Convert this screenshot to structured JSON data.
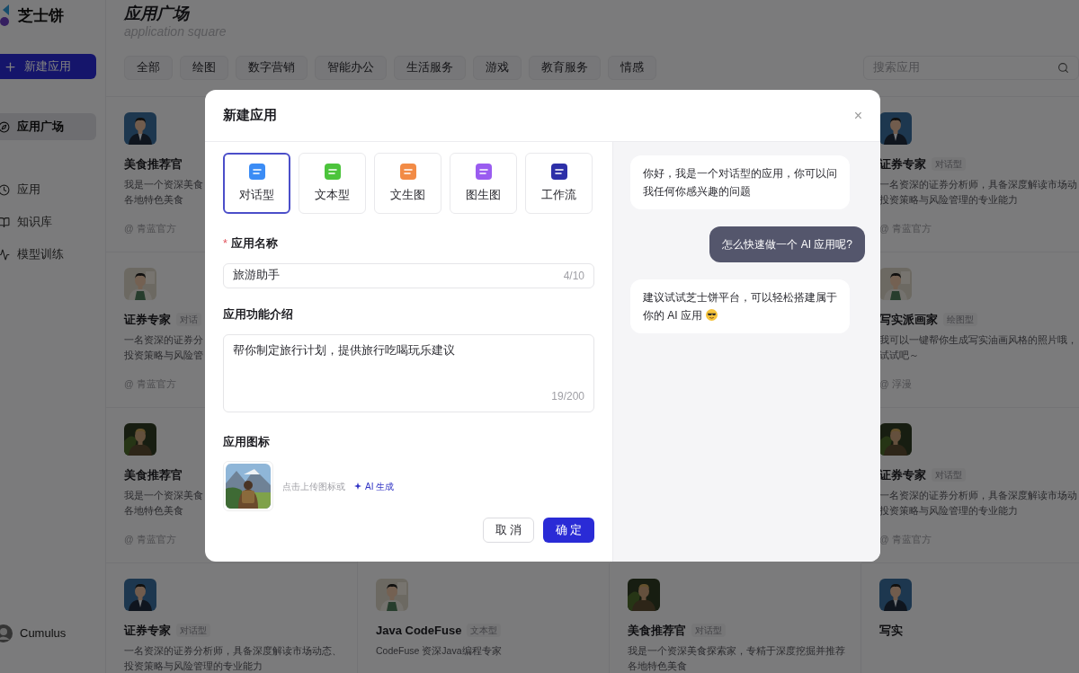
{
  "sidebar": {
    "logo": "芝士饼",
    "new_button": "新建应用",
    "nav": [
      {
        "label": "应用广场",
        "selected": true
      },
      {
        "label": "应用",
        "selected": false
      },
      {
        "label": "知识库",
        "selected": false
      },
      {
        "label": "模型训练",
        "selected": false
      }
    ],
    "user": {
      "name": "Cumulus"
    }
  },
  "page": {
    "title": "应用广场",
    "subtitle": "application square"
  },
  "filters": [
    "全部",
    "绘图",
    "数字营销",
    "智能办公",
    "生活服务",
    "游戏",
    "教育服务",
    "情感"
  ],
  "search": {
    "placeholder": "搜索应用"
  },
  "left_column": [
    {
      "title": "美食推荐官",
      "lines": [
        "我是一个资深美食",
        "各地特色美食"
      ],
      "author": "@ 青蓝官方"
    },
    {
      "title": "证券专家",
      "badge": "对话",
      "lines": [
        "一名资深的证券分",
        "投资策略与风险管"
      ],
      "author": "@ 青蓝官方"
    },
    {
      "title": "美食推荐官",
      "lines": [
        "我是一个资深美食",
        "各地特色美食"
      ],
      "author": "@ 青蓝官方"
    }
  ],
  "right_column": [
    {
      "title": "证券专家",
      "badge": "对话型",
      "lines": [
        "一名资深的证券分析师，具备深度解读市场动",
        "投资策略与风险管理的专业能力"
      ],
      "author": "@ 青蓝官方"
    },
    {
      "title": "写实派画家",
      "badge": "绘图型",
      "lines": [
        "我可以一键帮你生成写实油画风格的照片哦，",
        "试试吧～"
      ],
      "author": "@ 浮漫"
    },
    {
      "title": "证券专家",
      "badge": "对话型",
      "lines": [
        "一名资深的证券分析师，具备深度解读市场动",
        "投资策略与风险管理的专业能力"
      ],
      "author": "@ 青蓝官方"
    }
  ],
  "bottom_row": [
    {
      "title": "证券专家",
      "badge": "对话型",
      "lines": [
        "一名资深的证券分析师，具备深度解读市场动态、",
        "投资策略与风险管理的专业能力"
      ]
    },
    {
      "title": "Java CodeFuse",
      "badge": "文本型",
      "lines": [
        "CodeFuse 资深Java编程专家"
      ]
    },
    {
      "title": "美食推荐官",
      "badge": "对话型",
      "lines": [
        "我是一个资深美食探索家，专精于深度挖掘并推荐",
        "各地特色美食"
      ]
    },
    {
      "title": "写实"
    }
  ],
  "dialog": {
    "title": "新建应用",
    "close": "×",
    "types": [
      {
        "label": "对话型",
        "selected": true,
        "color": "#3b8cf5"
      },
      {
        "label": "文本型",
        "selected": false,
        "color": "#4cc43c"
      },
      {
        "label": "文生图",
        "selected": false,
        "color": "#f28b46"
      },
      {
        "label": "图生图",
        "selected": false,
        "color": "#9a5cf0"
      },
      {
        "label": "工作流",
        "selected": false,
        "color": "#2d2fa8"
      }
    ],
    "name_field": {
      "required_mark": "*",
      "label": "应用名称",
      "value": "旅游助手",
      "count": "4/10"
    },
    "intro_field": {
      "label": "应用功能介绍",
      "value": "帮你制定旅行计划，提供旅行吃喝玩乐建议",
      "count": "19/200"
    },
    "icon_field": {
      "label": "应用图标",
      "hint": "点击上传图标或",
      "ai_link": "AI 生成"
    },
    "buttons": [
      {
        "label": "取 消",
        "kind": "secondary"
      },
      {
        "label": "确 定",
        "kind": "primary"
      }
    ],
    "chat": [
      {
        "kind": "bot",
        "text": "你好，我是一个对话型的应用，你可以问我任何你感兴趣的问题"
      },
      {
        "kind": "user",
        "text": "怎么快速做一个 AI 应用呢?"
      },
      {
        "kind": "bot",
        "text": "建议试试芝士饼平台，可以轻松搭建属于你的 AI 应用",
        "emoji": true
      }
    ]
  }
}
